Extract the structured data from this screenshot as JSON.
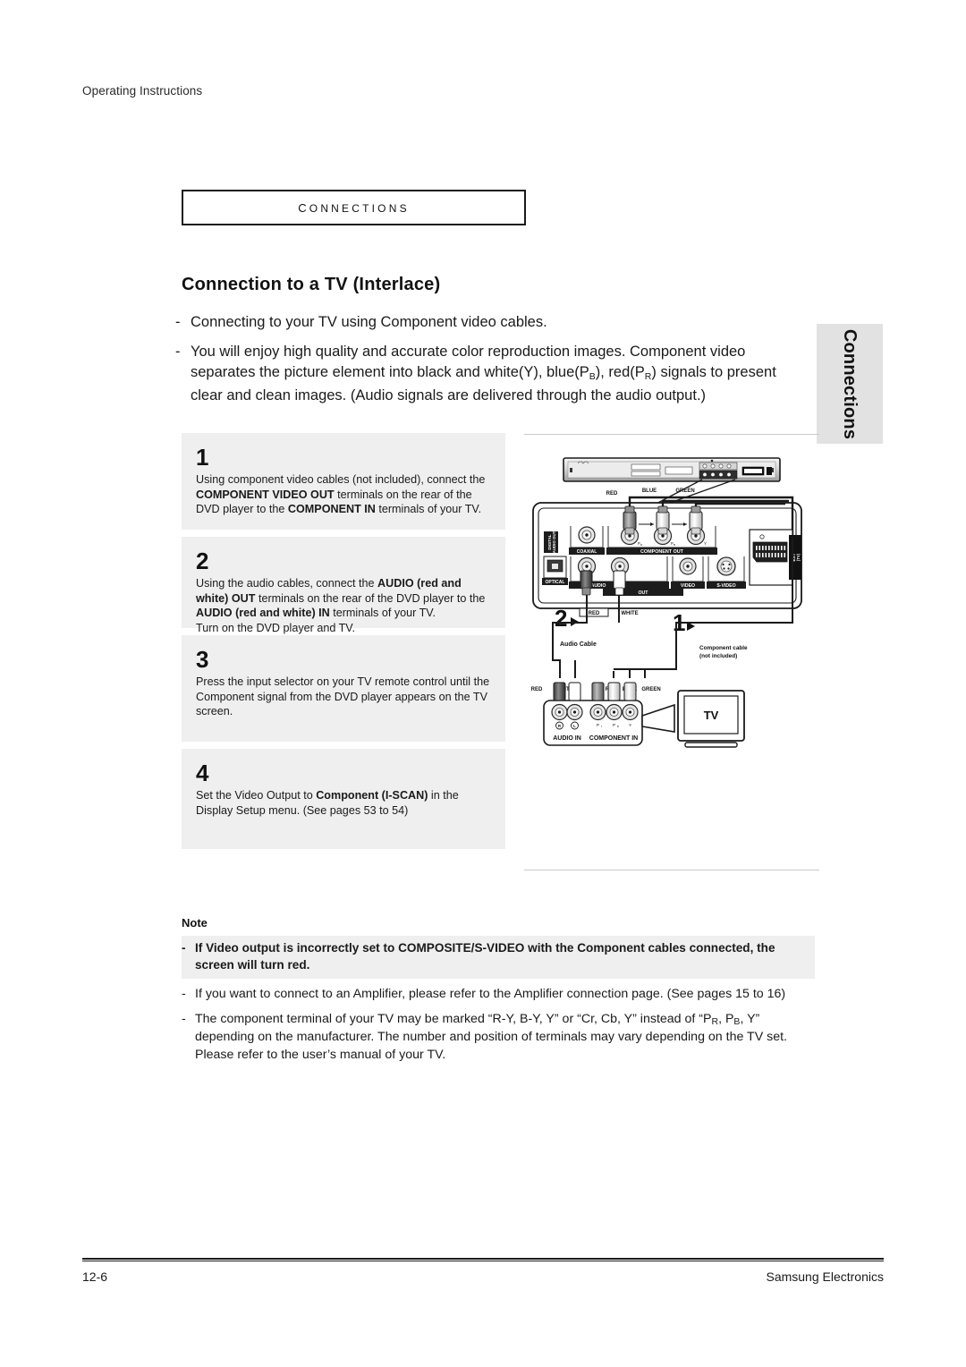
{
  "page": {
    "running_head": "Operating Instructions",
    "section_label": "Connections",
    "heading": "Connection to a TV (Interlace)",
    "side_tab": "Connections"
  },
  "intro": {
    "dash": "-",
    "bullets": [
      {
        "parts": [
          {
            "t": "text",
            "v": "Connecting to your TV using Component video cables."
          }
        ]
      },
      {
        "parts": [
          {
            "t": "text",
            "v": "You will enjoy high quality and accurate color reproduction images. Component video separates the picture element into black and white(Y), blue(P"
          },
          {
            "t": "sub",
            "v": "B"
          },
          {
            "t": "text",
            "v": "), red(P"
          },
          {
            "t": "sub",
            "v": "R"
          },
          {
            "t": "text",
            "v": ") signals to present clear and clean images. (Audio signals are delivered through the audio output.)"
          }
        ]
      }
    ]
  },
  "steps": [
    {
      "number": "1",
      "parts": [
        {
          "t": "text",
          "v": "Using component video cables (not included), connect the "
        },
        {
          "t": "bold",
          "v": "COMPONENT VIDEO OUT"
        },
        {
          "t": "text",
          "v": " terminals on the rear of the DVD player to the "
        },
        {
          "t": "bold",
          "v": "COMPONENT IN"
        },
        {
          "t": "text",
          "v": " terminals of your TV."
        }
      ]
    },
    {
      "number": "2",
      "parts": [
        {
          "t": "text",
          "v": "Using the audio cables, connect the "
        },
        {
          "t": "bold",
          "v": "AUDIO (red and white) OUT"
        },
        {
          "t": "text",
          "v": " terminals on the rear of the DVD player to the "
        },
        {
          "t": "bold",
          "v": "AUDIO (red and white) IN"
        },
        {
          "t": "text",
          "v": " terminals of your TV."
        },
        {
          "t": "br",
          "v": ""
        },
        {
          "t": "text",
          "v": "Turn on the DVD player and TV."
        }
      ]
    },
    {
      "number": "3",
      "parts": [
        {
          "t": "text",
          "v": "Press the input selector on your TV remote control until the Component signal from the DVD player appears on the TV screen."
        }
      ]
    },
    {
      "number": "4",
      "parts": [
        {
          "t": "text",
          "v": "Set the Video Output to "
        },
        {
          "t": "bold",
          "v": "Component (I-SCAN)"
        },
        {
          "t": "text",
          "v": " in the Display Setup menu. (See pages 53 to 54)"
        }
      ]
    }
  ],
  "note": {
    "title": "Note",
    "dash": "-",
    "items": [
      {
        "highlight": true,
        "bold": true,
        "text": "If Video output is incorrectly set to COMPOSITE/S-VIDEO with the Component cables connected, the screen will turn red."
      },
      {
        "highlight": false,
        "bold": false,
        "text": "If you want to connect to an Amplifier, please refer to the Amplifier connection page. (See pages 15 to 16)"
      },
      {
        "highlight": false,
        "bold": false,
        "parts": [
          {
            "t": "text",
            "v": "The component terminal of your TV may be marked “R-Y, B-Y, Y” or “Cr, Cb, Y” instead of “P"
          },
          {
            "t": "sub",
            "v": "R"
          },
          {
            "t": "text",
            "v": ", P"
          },
          {
            "t": "sub",
            "v": "B"
          },
          {
            "t": "text",
            "v": ", Y” depending on the manufacturer. The number and position of terminals may vary depending on the TV set. Please refer to the user’s manual of your TV."
          }
        ]
      }
    ]
  },
  "diagram": {
    "dvd_rear_labels": {
      "digital_audio_out": "DIGITAL AUDIO OUT",
      "coaxial": "COAXIAL",
      "optical": "OPTICAL",
      "component_out": "COMPONENT OUT",
      "audio": "AUDIO",
      "out": "OUT",
      "video": "VIDEO",
      "svideo": "S-VIDEO",
      "ext_tv": "EXT (TV)"
    },
    "component_plug_colors": [
      "RED",
      "BLUE",
      "GREEN"
    ],
    "component_plug_pins": [
      "Pʀ",
      "Pʙ",
      "Y"
    ],
    "audio_plug_colors": [
      "RED",
      "WHITE"
    ],
    "callout_2": "2",
    "callout_1": "1",
    "audio_cable_label": "Audio Cable",
    "component_cable_label_line1": "Component cable",
    "component_cable_label_line2": "(not included)",
    "tv_panel": {
      "audio_in": "AUDIO IN",
      "component_in": "COMPONENT IN",
      "audio_jacks": [
        "R",
        "L"
      ],
      "component_jacks": [
        "Pʀ",
        "Pʙ",
        "Y"
      ],
      "colors_audio": [
        "RED",
        "WHITE"
      ],
      "colors_component": [
        "RED",
        "BLUE",
        "GREEN"
      ]
    },
    "tv_label": "TV"
  },
  "footer": {
    "page_number": "12-6",
    "company": "Samsung Electronics"
  }
}
